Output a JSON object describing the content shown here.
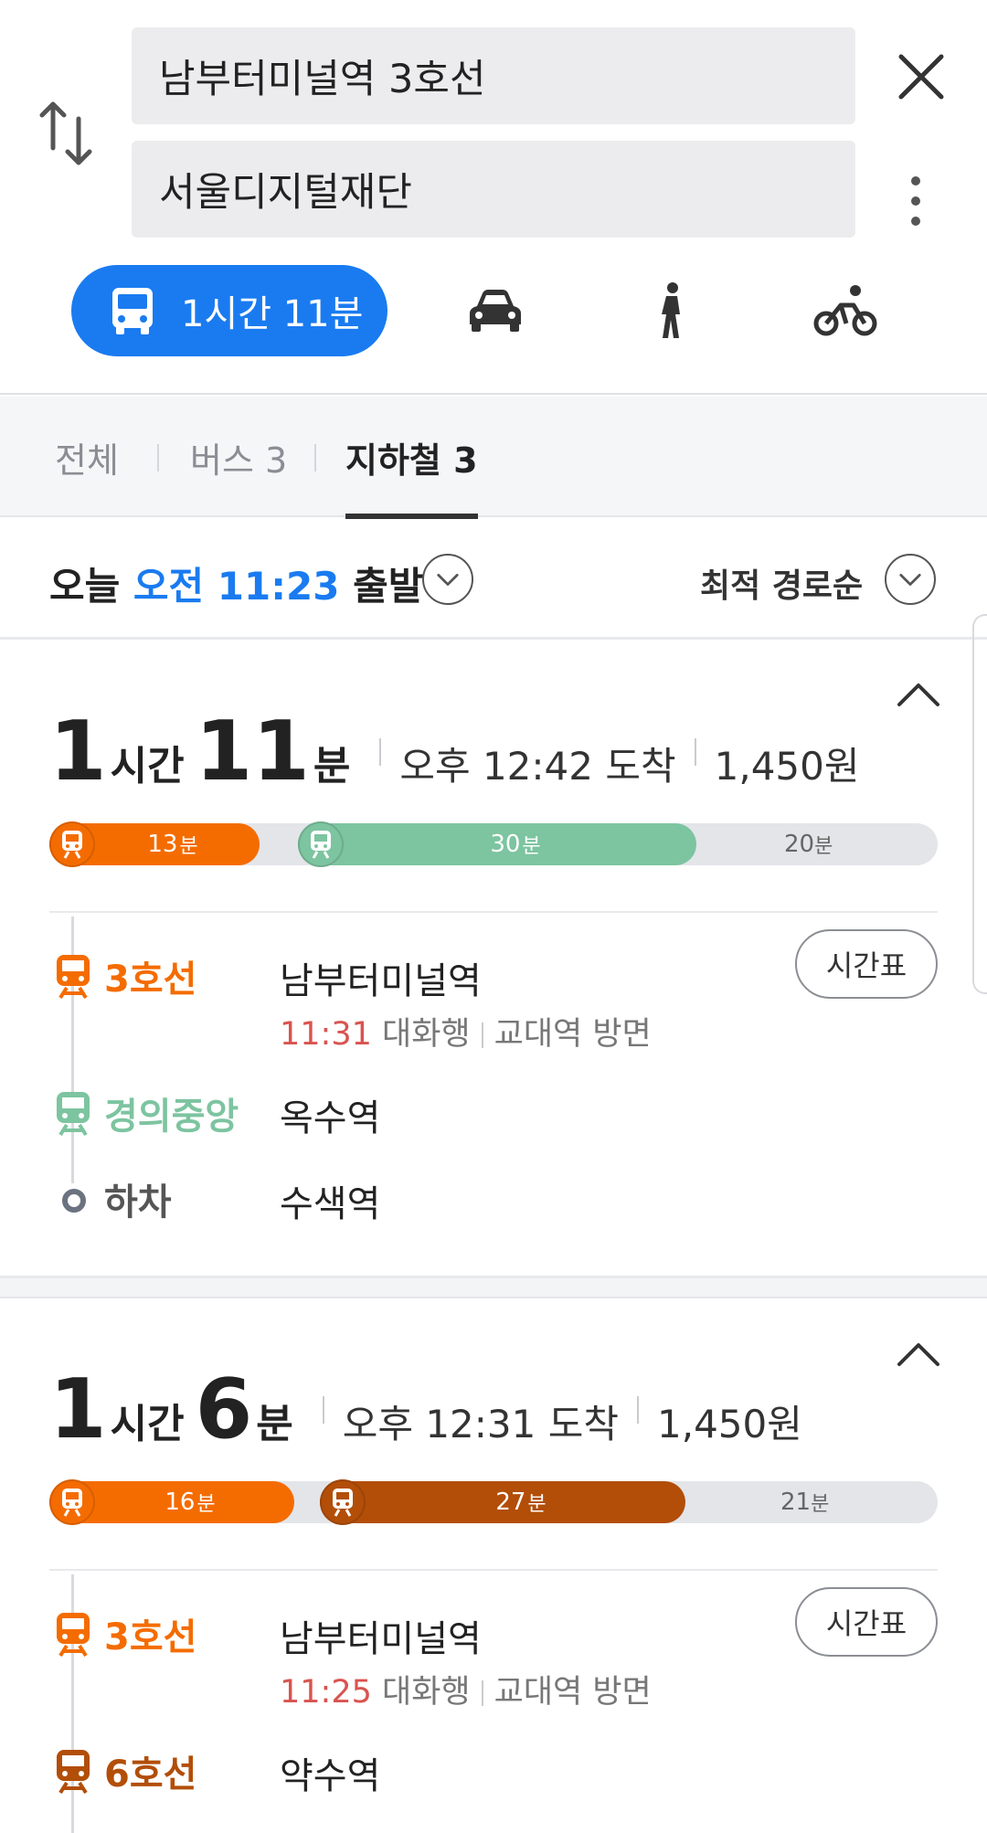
{
  "search": {
    "origin": "남부터미널역 3호선",
    "destination": "서울디지털재단"
  },
  "modes": {
    "transit_label": "1시간 11분",
    "items": [
      "bus-icon",
      "car-icon",
      "walk-icon",
      "bike-icon"
    ]
  },
  "filter_tabs": [
    {
      "label": "전체"
    },
    {
      "label": "버스 3"
    },
    {
      "label": "지하철 3"
    }
  ],
  "departure": {
    "prefix": "오늘",
    "time": "오전 11:23",
    "suffix": "출발",
    "sort_label": "최적 경로순"
  },
  "colors": {
    "accent_blue": "#1a7bf0",
    "line3": "#f46c00",
    "gyeongui": "#7dc4a0",
    "line6": "#b24e08",
    "walk_bar": "#e3e5e9",
    "time_red": "#d9534f"
  },
  "routes": [
    {
      "hours": "1",
      "hours_unit": "시간",
      "minutes": "11",
      "minutes_unit": "분",
      "arrival": "오후 12:42 도착",
      "fare": "1,450원",
      "segments": [
        {
          "minutes": "13",
          "unit": "분",
          "type": "subway",
          "line": "3호선"
        },
        {
          "minutes": "30",
          "unit": "분",
          "type": "subway",
          "line": "경의중앙"
        },
        {
          "minutes": "20",
          "unit": "분",
          "type": "walk"
        }
      ],
      "steps": [
        {
          "line": "3호선",
          "station": "남부터미널역",
          "time": "11:31",
          "direction": "대화행",
          "platform": "교대역 방면",
          "button": "시간표"
        },
        {
          "line": "경의중앙",
          "station": "옥수역"
        },
        {
          "line": "하차",
          "station": "수색역"
        }
      ]
    },
    {
      "hours": "1",
      "hours_unit": "시간",
      "minutes": "6",
      "minutes_unit": "분",
      "arrival": "오후 12:31 도착",
      "fare": "1,450원",
      "segments": [
        {
          "minutes": "16",
          "unit": "분",
          "type": "subway",
          "line": "3호선"
        },
        {
          "minutes": "27",
          "unit": "분",
          "type": "subway",
          "line": "6호선"
        },
        {
          "minutes": "21",
          "unit": "분",
          "type": "walk"
        }
      ],
      "steps": [
        {
          "line": "3호선",
          "station": "남부터미널역",
          "time": "11:25",
          "direction": "대화행",
          "platform": "교대역 방면",
          "button": "시간표"
        },
        {
          "line": "6호선",
          "station": "약수역"
        }
      ]
    }
  ]
}
